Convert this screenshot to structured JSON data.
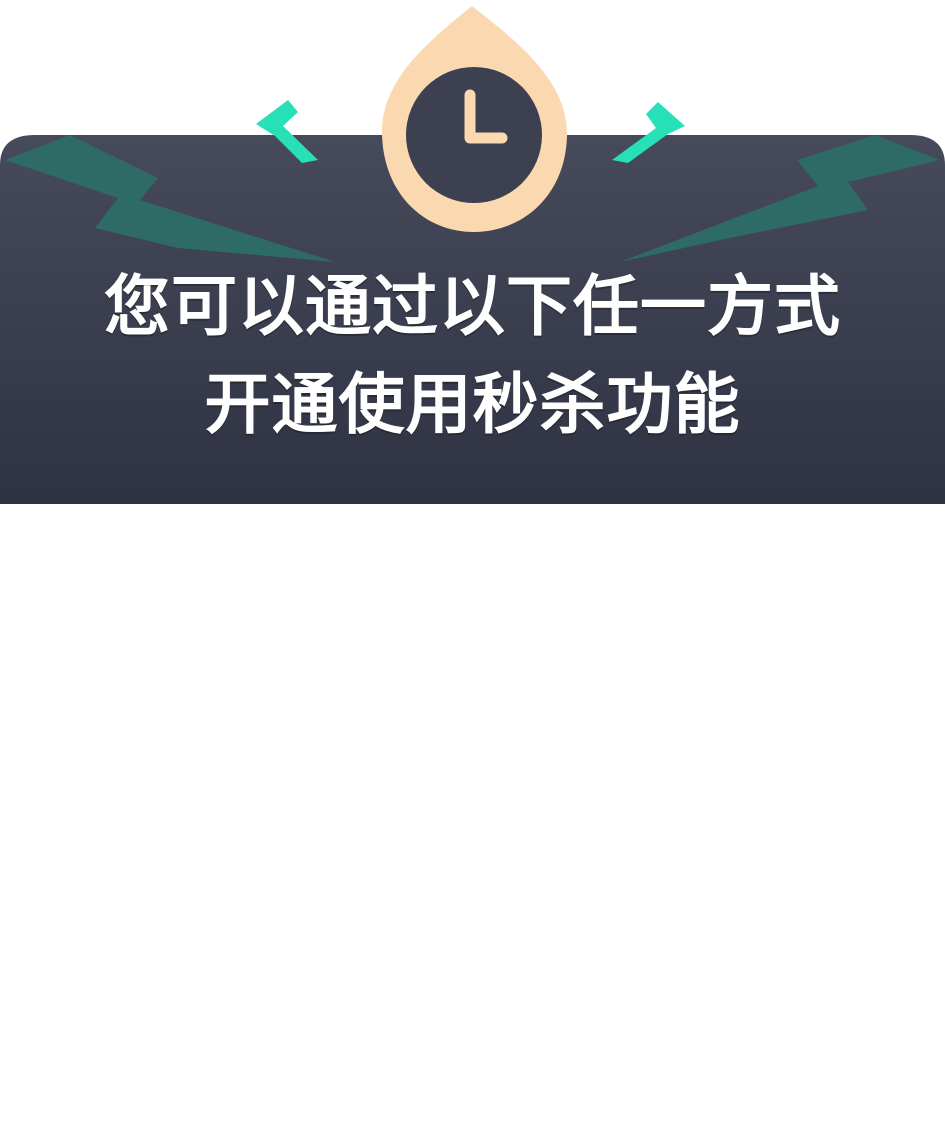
{
  "dialog": {
    "headline_line1": "您可以通过以下任一方式",
    "headline_line2": "开通使用秒杀功能"
  },
  "icons": {
    "clock": "clock-icon",
    "lightning_left": "lightning-bolt-icon",
    "lightning_right": "lightning-bolt-icon",
    "spark_left": "spark-icon",
    "spark_right": "spark-icon"
  },
  "colors": {
    "card_top": "#464a5a",
    "card_bottom": "#2f3242",
    "bolt": "#2e6b66",
    "spark": "#27e0b8",
    "clock_ring": "#fbd9b0",
    "clock_face": "#3d4050",
    "headline": "#ffffff"
  }
}
